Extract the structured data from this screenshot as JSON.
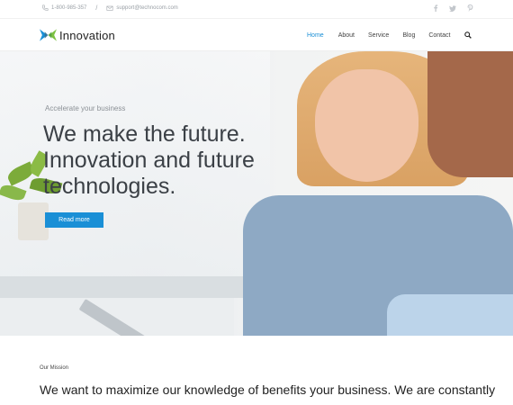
{
  "topbar": {
    "phone": "1-800-985-357",
    "separator": "/",
    "email": "support@technocom.com",
    "social_icons": [
      "facebook-icon",
      "twitter-icon",
      "pinterest-icon"
    ]
  },
  "header": {
    "logo_text": "Innovation",
    "nav": [
      {
        "label": "Home",
        "active": true
      },
      {
        "label": "About",
        "active": false
      },
      {
        "label": "Service",
        "active": false
      },
      {
        "label": "Blog",
        "active": false
      },
      {
        "label": "Contact",
        "active": false
      }
    ],
    "search_icon": "search-icon"
  },
  "hero": {
    "subtitle": "Accelerate your business",
    "title_line1": "We make the future.",
    "title_line2": "Innovation and future",
    "title_line3": "technologies.",
    "button_label": "Read more"
  },
  "mission": {
    "label": "Our Mission",
    "text": "We want to maximize our knowledge of benefits your business. We are constantly"
  },
  "colors": {
    "accent": "#1a8fd6",
    "text_dark": "#222222",
    "text_muted": "#9aa0a6"
  }
}
